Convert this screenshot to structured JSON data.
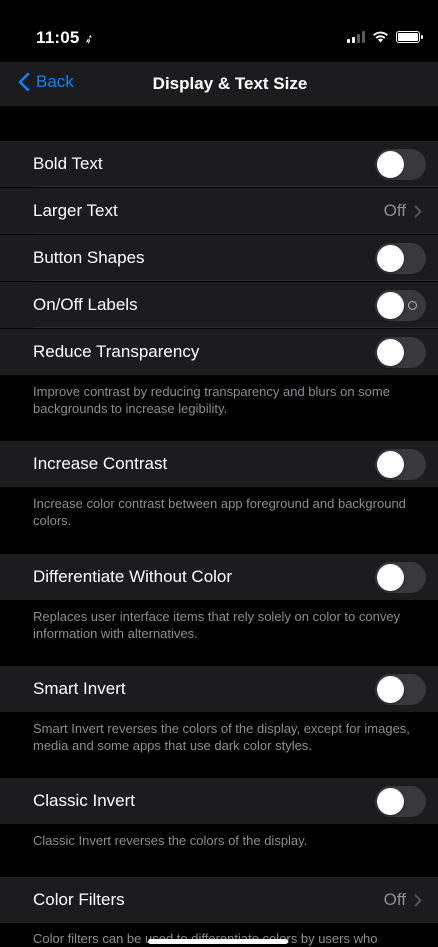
{
  "status_bar": {
    "time": "11:05",
    "location_arrow": "➶"
  },
  "nav": {
    "back_label": "Back",
    "title": "Display & Text Size"
  },
  "rows": {
    "bold_text": {
      "label": "Bold Text",
      "on": false
    },
    "larger_text": {
      "label": "Larger Text",
      "value": "Off"
    },
    "button_shapes": {
      "label": "Button Shapes",
      "on": false
    },
    "onoff_labels": {
      "label": "On/Off Labels",
      "on": false
    },
    "reduce_transparency": {
      "label": "Reduce Transparency",
      "on": false
    },
    "increase_contrast": {
      "label": "Increase Contrast",
      "on": false
    },
    "differentiate_without_color": {
      "label": "Differentiate Without Color",
      "on": false
    },
    "smart_invert": {
      "label": "Smart Invert",
      "on": false
    },
    "classic_invert": {
      "label": "Classic Invert",
      "on": false
    },
    "color_filters": {
      "label": "Color Filters",
      "value": "Off"
    }
  },
  "footers": {
    "reduce_transparency": "Improve contrast by reducing transparency and blurs on some backgrounds to increase legibility.",
    "increase_contrast": "Increase color contrast between app foreground and background colors.",
    "differentiate_without_color": "Replaces user interface items that rely solely on color to convey information with alternatives.",
    "smart_invert": "Smart Invert reverses the colors of the display, except for images, media and some apps that use dark color styles.",
    "classic_invert": "Classic Invert reverses the colors of the display.",
    "color_filters": "Color filters can be used to differentiate colors by users who"
  },
  "colors": {
    "accent": "#0a84ff",
    "cell_bg": "#1c1c1e",
    "background": "#000000",
    "secondary_text": "#8e8e93",
    "toggle_off": "#39393d"
  },
  "icons": [
    "location-arrow-icon",
    "cellular-signal-icon",
    "wifi-icon",
    "battery-icon",
    "chevron-left-icon",
    "chevron-right-icon"
  ]
}
